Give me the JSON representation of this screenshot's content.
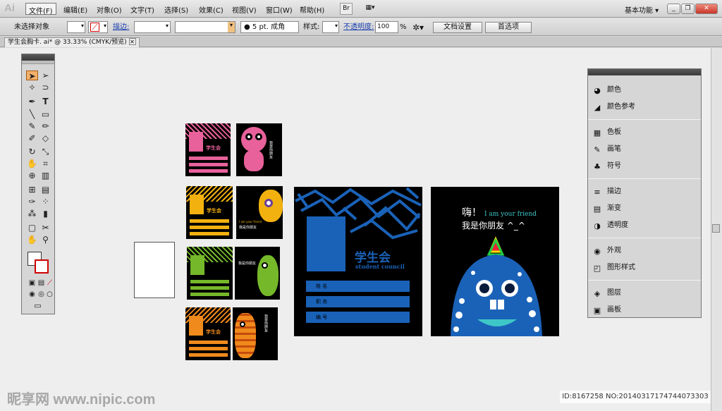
{
  "app": {
    "logo": "Ai",
    "workspace": "基本功能"
  },
  "menu": [
    "文件(F)",
    "编辑(E)",
    "对象(O)",
    "文字(T)",
    "选择(S)",
    "效果(C)",
    "视图(V)",
    "窗口(W)",
    "帮助(H)"
  ],
  "toolbar": {
    "bridge": "Br",
    "arrange": "▦▾"
  },
  "window_buttons": {
    "minimize": "_",
    "restore": "❐",
    "close": "✕"
  },
  "control": {
    "selection": "未选择对象",
    "stroke_label": "描边:",
    "brush_value": "● 5 pt. 成角",
    "style_label": "样式:",
    "opacity_label": "不透明度:",
    "opacity_value": "100",
    "percent": "%",
    "doc_setup": "文档设置",
    "prefs": "首选项"
  },
  "document_tab": {
    "title": "学生会胸卡. ai* @ 33.33% (CMYK/预览)",
    "close": "✕"
  },
  "panel": {
    "groups": [
      [
        {
          "icon": "palette-icon",
          "glyph": "◕",
          "label": "颜色"
        },
        {
          "icon": "color-guide-icon",
          "glyph": "◢",
          "label": "颜色参考"
        }
      ],
      [
        {
          "icon": "swatches-icon",
          "glyph": "▦",
          "label": "色板"
        },
        {
          "icon": "brushes-icon",
          "glyph": "✎",
          "label": "画笔"
        },
        {
          "icon": "symbols-icon",
          "glyph": "♣",
          "label": "符号"
        }
      ],
      [
        {
          "icon": "stroke-icon",
          "glyph": "≡",
          "label": "描边"
        },
        {
          "icon": "gradient-icon",
          "glyph": "▤",
          "label": "渐变"
        },
        {
          "icon": "transparency-icon",
          "glyph": "◑",
          "label": "透明度"
        }
      ],
      [
        {
          "icon": "appearance-icon",
          "glyph": "◉",
          "label": "外观"
        },
        {
          "icon": "graphic-styles-icon",
          "glyph": "◰",
          "label": "图形样式"
        }
      ],
      [
        {
          "icon": "layers-icon",
          "glyph": "◈",
          "label": "图层"
        },
        {
          "icon": "artboards-icon",
          "glyph": "▣",
          "label": "画板"
        }
      ]
    ]
  },
  "art": {
    "title": "学生会",
    "subtitle": "student council",
    "greeting": "嗨！",
    "greeting_en": "I am your friend",
    "friend": "我是你朋友 ^_^",
    "small_friend": "我是你朋友",
    "small_en": "I am your friend",
    "field1": "姓 名",
    "field2": "职 务",
    "field3": "编 号"
  },
  "colors": {
    "blue": "#1a62b8",
    "pink": "#e8619a",
    "yellow": "#f2b10f",
    "green": "#75b82a",
    "orange": "#f08a1c"
  },
  "watermark": {
    "id": "ID:8167258 NO:20140317174744073303",
    "site": "昵享网 www.nipic.com"
  }
}
